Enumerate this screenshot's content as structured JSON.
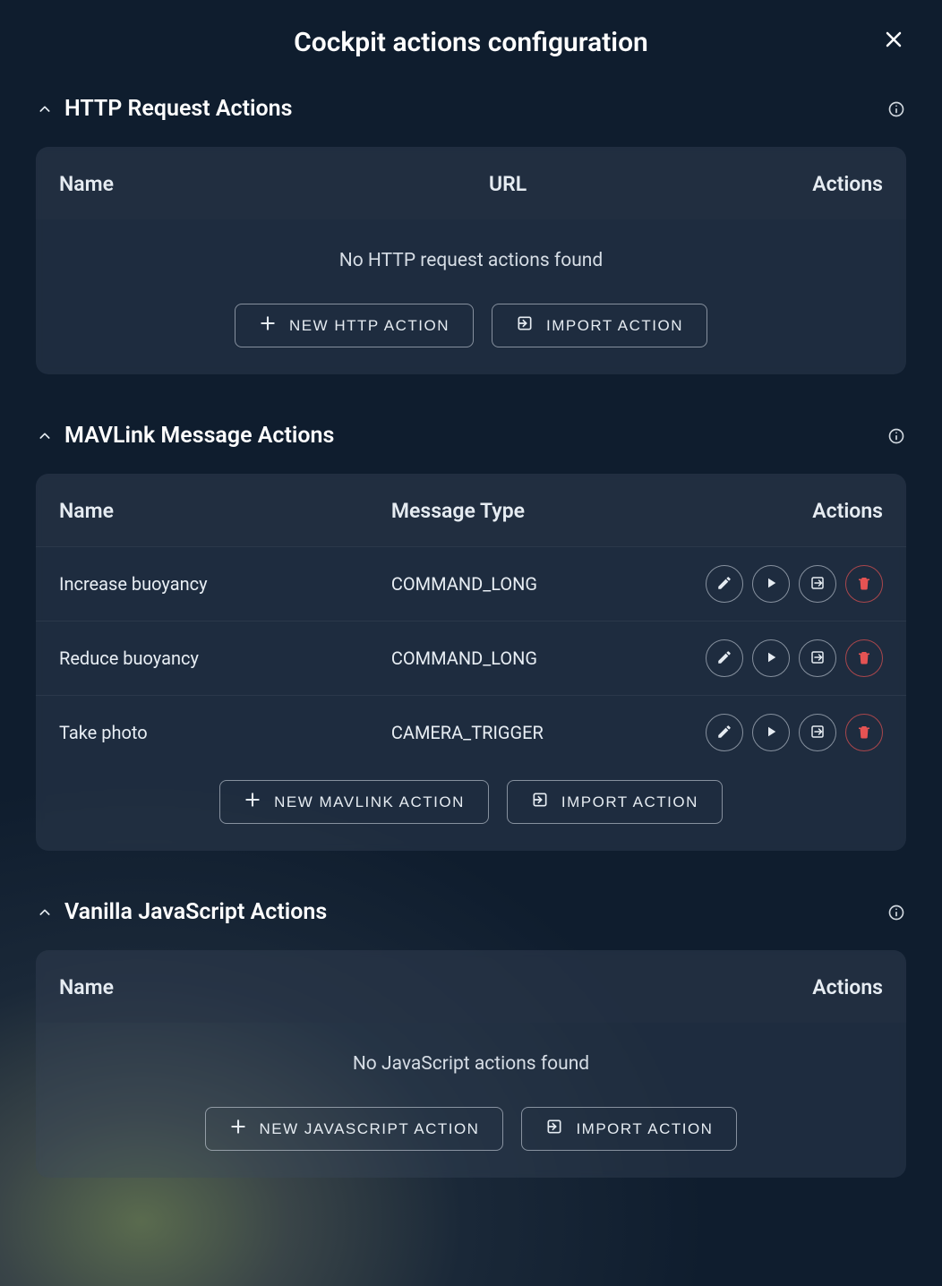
{
  "dialog": {
    "title": "Cockpit actions configuration"
  },
  "buttons": {
    "import_action": "IMPORT ACTION"
  },
  "sections": {
    "http": {
      "title": "HTTP Request Actions",
      "columns": {
        "name": "Name",
        "url": "URL",
        "actions": "Actions"
      },
      "empty": "No HTTP request actions found",
      "new_label": "NEW HTTP ACTION"
    },
    "mavlink": {
      "title": "MAVLink Message Actions",
      "columns": {
        "name": "Name",
        "message_type": "Message Type",
        "actions": "Actions"
      },
      "new_label": "NEW MAVLINK ACTION",
      "rows": [
        {
          "name": "Increase buoyancy",
          "message_type": "COMMAND_LONG"
        },
        {
          "name": "Reduce buoyancy",
          "message_type": "COMMAND_LONG"
        },
        {
          "name": "Take photo",
          "message_type": "CAMERA_TRIGGER"
        }
      ]
    },
    "js": {
      "title": "Vanilla JavaScript Actions",
      "columns": {
        "name": "Name",
        "actions": "Actions"
      },
      "empty": "No JavaScript actions found",
      "new_label": "NEW JAVASCRIPT ACTION"
    }
  }
}
